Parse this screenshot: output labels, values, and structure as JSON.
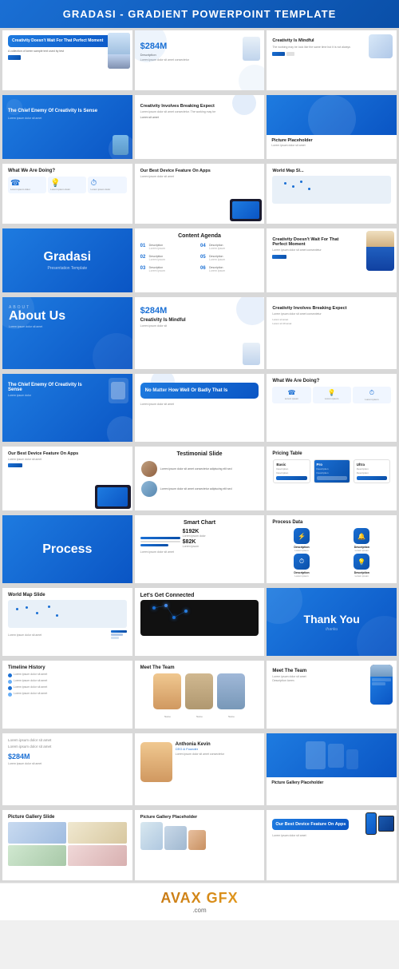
{
  "header": {
    "title": "GRADASI - GRADIENT POWERPOINT TEMPLATE"
  },
  "slides": {
    "row1": {
      "s1": {
        "title": "Creativity Doesn't Wait For That Perfect Moment",
        "stat": "",
        "desc": "A collection of lorem sample text used by test"
      },
      "s2": {
        "stat": "$284M",
        "label": "Description",
        "desc": "Lorem ipsum dolor sit amet"
      },
      "s3": {
        "title": "Creativity Is Mindful",
        "desc": "The working may be look like the same time but it is not always the same"
      }
    },
    "row2": {
      "s1": {
        "title": "The Chief Enemy Of Creativity Is Sense",
        "desc": "Lorem ipsum dolor sit amet"
      },
      "s2": {
        "title": "Creativity Involves Breaking Expect",
        "desc": "Lorem ipsum dolor sit amet consectetur"
      },
      "s3": {
        "label": "Picture Placeholder",
        "desc": ""
      }
    },
    "row3": {
      "s1": {
        "title": "What We Are Doing?",
        "desc": "Lorem ipsum dolor"
      },
      "s2": {
        "title": "Our Best Device Feature On Apps",
        "desc": "Lorem ipsum dolor sit amet"
      },
      "s3": {
        "title": "World Map Sl...",
        "desc": "Lorem ipsum dolor sit"
      }
    },
    "row4": {
      "s1": {
        "title": "Gradasi",
        "sub": "Presentation Template"
      },
      "s2": {
        "title": "Content Agenda",
        "items": [
          "01 Description",
          "02 Description",
          "03 Description",
          "04 Description",
          "05 Description",
          "06 Description"
        ]
      },
      "s3": {
        "title": "Creativity Doesn't Wait For That Perfect Moment",
        "desc": "Lorem ipsum dolor sit amet"
      }
    },
    "row5": {
      "s1": {
        "title": "About Us",
        "desc": "Lorem ipsum dolor sit amet"
      },
      "s2": {
        "stat": "$284M",
        "title": "Creativity Is Mindful",
        "desc": "Lorem ipsum"
      },
      "s3": {
        "title": "Creativity Involves Breaking Expect",
        "desc": "Lorem ipsum dolor"
      }
    },
    "row6": {
      "s1": {
        "title": "The Chief Enemy Of Creativity Is Sense",
        "desc": "Lorem ipsum dolor"
      },
      "s2": {
        "title": "No Matter How Well Or Badly That Is",
        "desc": "Lorem ipsum dolor sit amet"
      },
      "s3": {
        "title": "What We Are Doing?",
        "desc": "Lorem ipsum dolor"
      }
    },
    "row7": {
      "s1": {
        "title": "Our Best Device Feature On Apps",
        "desc": "Lorem ipsum dolor"
      },
      "s2": {
        "title": "Testimonial Slide",
        "desc": "Lorem ipsum dolor sit amet"
      },
      "s3": {
        "title": "Pricing Table",
        "cols": [
          "Basic",
          "Pro",
          "Ultra"
        ]
      }
    },
    "row8": {
      "s1": {
        "title": "Process",
        "sub": ""
      },
      "s2": {
        "title": "Smart Chart",
        "stat1": "$192K",
        "stat2": "$82K",
        "desc": "Lorem ipsum dolor sit amet"
      },
      "s3": {
        "title": "Process Data",
        "desc": "Lorem ipsum dolor"
      }
    },
    "row9": {
      "s1": {
        "title": "World Map Slide",
        "desc": "Lorem ipsum dolor sit amet"
      },
      "s2": {
        "title": "Let's Get Connected",
        "desc": "Lorem ipsum dolor"
      },
      "s3": {
        "title": "Thank You",
        "sub": "thanku"
      }
    },
    "row10": {
      "s1": {
        "title": "Timeline History",
        "desc": "Lorem ipsum dolor sit amet"
      },
      "s2": {
        "title": "Meet The Team",
        "desc": "Lorem ipsum dolor"
      },
      "s3": {
        "title": "Meet The Team",
        "desc": "Lorem ipsum dolor"
      }
    },
    "row11": {
      "s1": {
        "title": "Lorem ipsum dolor sit amet",
        "desc": "Lorem ipsum dolor"
      },
      "s2": {
        "title": "Anthonia Kevin",
        "role": "CEO & Founder",
        "desc": "Lorem ipsum dolor sit amet"
      },
      "s3": {
        "title": "Picture Gallery Placeholder",
        "desc": ""
      }
    },
    "row12": {
      "s1": {
        "title": "Picture Gallery Slide",
        "desc": "Lorem ipsum dolor"
      },
      "s2": {
        "title": "Picture Gallery Placeholder",
        "desc": ""
      },
      "s3": {
        "title": "Our Best Device Feature On Apps",
        "desc": "Lorem ipsum dolor"
      }
    }
  },
  "footer": {
    "logo": "AVAX GFX",
    "domain": ".com"
  }
}
